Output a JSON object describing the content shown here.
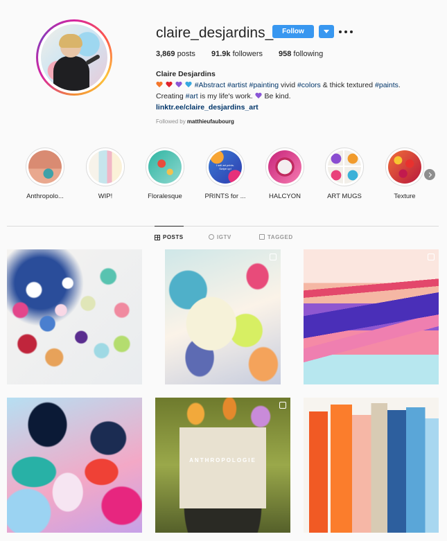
{
  "profile": {
    "username": "claire_desjardins_art",
    "follow_label": "Follow",
    "stats": {
      "posts_count": "3,869",
      "posts_label": " posts",
      "followers_count": "91.9k",
      "followers_label": " followers",
      "following_count": "958",
      "following_label": " following"
    },
    "full_name": "Claire Desjardins",
    "bio": {
      "line1_tags": [
        "#Abstract",
        "#artist",
        "#painting",
        "#colors",
        "#paints"
      ],
      "word_vivid": " vivid ",
      "word_thick": " & thick textured ",
      "line2_a": "Creating ",
      "line2_tag": "#art",
      "line2_b": " is my life's work. ",
      "line2_c": " Be kind.",
      "link": "linktr.ee/claire_desjardins_art"
    },
    "followed_by_prefix": "Followed by ",
    "followed_by_user": "matthieufaubourg"
  },
  "colors": {
    "accent": "#3897f0",
    "heart_orange": "#f4772b",
    "heart_red": "#e0202b",
    "heart_purple": "#8a56d6",
    "heart_blue": "#35a8e0",
    "text": "#262626",
    "muted": "#8e8e8e"
  },
  "highlights": [
    {
      "label": "Anthropolo..."
    },
    {
      "label": "WIP!"
    },
    {
      "label": "Floralesque"
    },
    {
      "label": "PRINTS for ..."
    },
    {
      "label": "HALCYON"
    },
    {
      "label": "ART MUGS"
    },
    {
      "label": "Texture"
    }
  ],
  "highlight_prints_text": "I sell art prints. Swipe up!",
  "tabs": [
    {
      "label": "POSTS",
      "icon": "grid-icon",
      "active": true
    },
    {
      "label": "IGTV",
      "icon": "igtv-icon",
      "active": false
    },
    {
      "label": "TAGGED",
      "icon": "tagged-icon",
      "active": false
    }
  ],
  "posts": {
    "bag_text": "ANTHROPOLOGIE"
  }
}
